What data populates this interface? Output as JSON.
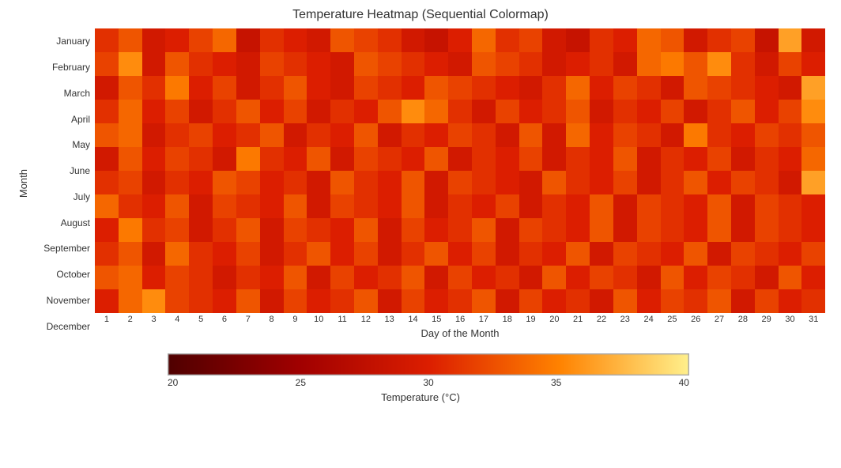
{
  "title": "Temperature Heatmap (Sequential Colormap)",
  "months": [
    "January",
    "February",
    "March",
    "April",
    "May",
    "June",
    "July",
    "August",
    "September",
    "October",
    "November",
    "December"
  ],
  "days": [
    1,
    2,
    3,
    4,
    5,
    6,
    7,
    8,
    9,
    10,
    11,
    12,
    13,
    14,
    15,
    16,
    17,
    18,
    19,
    20,
    21,
    22,
    23,
    24,
    25,
    26,
    27,
    28,
    29,
    30,
    31
  ],
  "y_axis_title": "Month",
  "x_axis_title": "Day of the Month",
  "colorbar_title": "Temperature (°C)",
  "colorbar_ticks": [
    "20",
    "25",
    "30",
    "35",
    "40"
  ],
  "heatmap": [
    [
      30,
      32,
      28,
      29,
      31,
      33,
      27,
      30,
      29,
      28,
      32,
      31,
      30,
      28,
      27,
      29,
      33,
      30,
      31,
      28,
      27,
      30,
      29,
      33,
      32,
      28,
      30,
      31,
      27,
      36,
      28
    ],
    [
      31,
      35,
      28,
      32,
      30,
      29,
      28,
      31,
      30,
      29,
      28,
      32,
      31,
      30,
      29,
      28,
      32,
      31,
      30,
      28,
      29,
      30,
      28,
      33,
      34,
      32,
      35,
      30,
      28,
      31,
      29
    ],
    [
      28,
      32,
      30,
      34,
      29,
      31,
      28,
      30,
      32,
      29,
      28,
      31,
      30,
      29,
      32,
      31,
      30,
      29,
      28,
      30,
      33,
      29,
      31,
      30,
      28,
      32,
      31,
      30,
      29,
      28,
      36
    ],
    [
      30,
      33,
      29,
      31,
      28,
      30,
      32,
      29,
      31,
      28,
      30,
      29,
      32,
      35,
      33,
      30,
      28,
      31,
      29,
      30,
      32,
      28,
      30,
      29,
      31,
      28,
      30,
      32,
      29,
      31,
      35
    ],
    [
      32,
      33,
      28,
      30,
      31,
      29,
      30,
      32,
      28,
      30,
      29,
      32,
      28,
      30,
      29,
      31,
      30,
      28,
      32,
      28,
      33,
      29,
      31,
      30,
      28,
      34,
      30,
      29,
      31,
      30,
      32
    ],
    [
      28,
      32,
      29,
      31,
      30,
      28,
      34,
      30,
      29,
      32,
      28,
      31,
      30,
      29,
      32,
      28,
      30,
      29,
      31,
      28,
      30,
      29,
      32,
      28,
      30,
      29,
      31,
      28,
      30,
      29,
      33
    ],
    [
      30,
      31,
      28,
      30,
      29,
      32,
      31,
      29,
      30,
      28,
      32,
      30,
      29,
      32,
      28,
      31,
      30,
      29,
      28,
      32,
      30,
      29,
      31,
      28,
      30,
      32,
      29,
      31,
      30,
      28,
      36
    ],
    [
      33,
      30,
      29,
      32,
      28,
      31,
      30,
      29,
      32,
      28,
      31,
      30,
      29,
      32,
      28,
      30,
      29,
      31,
      28,
      30,
      29,
      32,
      28,
      31,
      30,
      29,
      32,
      28,
      31,
      30,
      29
    ],
    [
      29,
      34,
      30,
      31,
      28,
      30,
      32,
      28,
      31,
      30,
      29,
      32,
      28,
      31,
      29,
      30,
      32,
      28,
      31,
      30,
      29,
      32,
      28,
      31,
      30,
      29,
      32,
      28,
      31,
      30,
      29
    ],
    [
      30,
      32,
      28,
      33,
      30,
      29,
      31,
      28,
      30,
      32,
      29,
      31,
      28,
      30,
      32,
      29,
      31,
      28,
      30,
      29,
      32,
      28,
      31,
      30,
      29,
      32,
      28,
      31,
      30,
      29,
      31
    ],
    [
      32,
      33,
      29,
      31,
      30,
      28,
      30,
      29,
      32,
      28,
      31,
      29,
      30,
      32,
      28,
      31,
      29,
      30,
      28,
      32,
      29,
      31,
      30,
      28,
      32,
      29,
      31,
      30,
      28,
      32,
      29
    ],
    [
      29,
      33,
      35,
      31,
      30,
      29,
      32,
      28,
      31,
      29,
      30,
      32,
      28,
      31,
      29,
      30,
      32,
      28,
      31,
      29,
      30,
      28,
      32,
      29,
      31,
      30,
      32,
      28,
      31,
      29,
      30
    ]
  ],
  "temp_min": 18,
  "temp_max": 40
}
